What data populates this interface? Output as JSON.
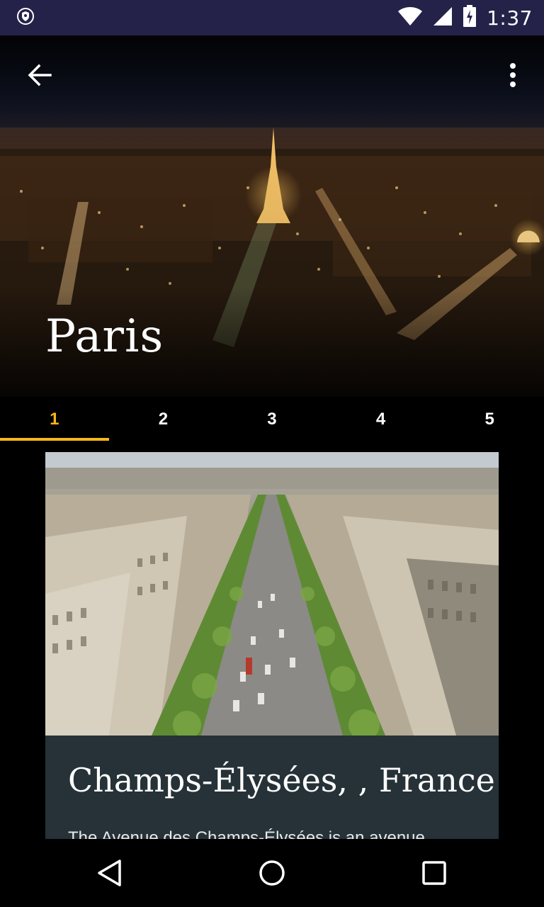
{
  "status_bar": {
    "time": "1:37",
    "icons": [
      "vpn-shield-icon",
      "wifi-icon",
      "cell-signal-icon",
      "battery-charging-icon"
    ]
  },
  "toolbar": {
    "back_icon": "arrow-back-icon",
    "menu_icon": "more-vert-icon"
  },
  "hero": {
    "title": "Paris"
  },
  "tabs": [
    {
      "label": "1",
      "active": true
    },
    {
      "label": "2",
      "active": false
    },
    {
      "label": "3",
      "active": false
    },
    {
      "label": "4",
      "active": false
    },
    {
      "label": "5",
      "active": false
    }
  ],
  "card": {
    "title": "Champs-Élysées, , France",
    "description": "The Avenue des Champs-Élysées is an avenue"
  },
  "nav_bar": {
    "icons": [
      "back-triangle-icon",
      "home-circle-icon",
      "recents-square-icon"
    ]
  },
  "colors": {
    "accent": "#f7b718",
    "status_bar": "#25224a",
    "card_background": "#263238"
  }
}
